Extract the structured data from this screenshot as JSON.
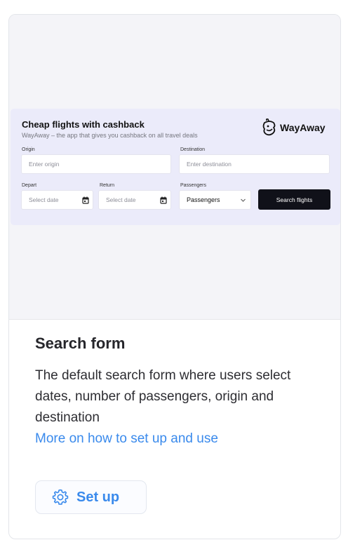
{
  "widget": {
    "title": "Cheap flights with cashback",
    "subtitle": "WayAway – the app that gives you cashback on all travel deals",
    "logo_text": "WayAway",
    "origin_label": "Origin",
    "origin_placeholder": "Enter origin",
    "destination_label": "Destination",
    "destination_placeholder": "Enter destination",
    "depart_label": "Depart",
    "depart_placeholder": "Select date",
    "return_label": "Return",
    "return_placeholder": "Select date",
    "passengers_label": "Passengers",
    "passengers_value": "Passengers",
    "search_button": "Search flights"
  },
  "info": {
    "title": "Search form",
    "description": "The default search form where users select dates, number of passengers, origin and destination",
    "link": "More on how to set up and use"
  },
  "setup": {
    "label": "Set up"
  },
  "icons": {
    "logo": "wayaway-mascot-icon",
    "calendar": "calendar-icon",
    "chevron": "chevron-down-icon",
    "setup": "gear-icon"
  },
  "colors": {
    "accent": "#3a8aec",
    "button_dark": "#101119",
    "widget_bg": "#ebebfa"
  }
}
